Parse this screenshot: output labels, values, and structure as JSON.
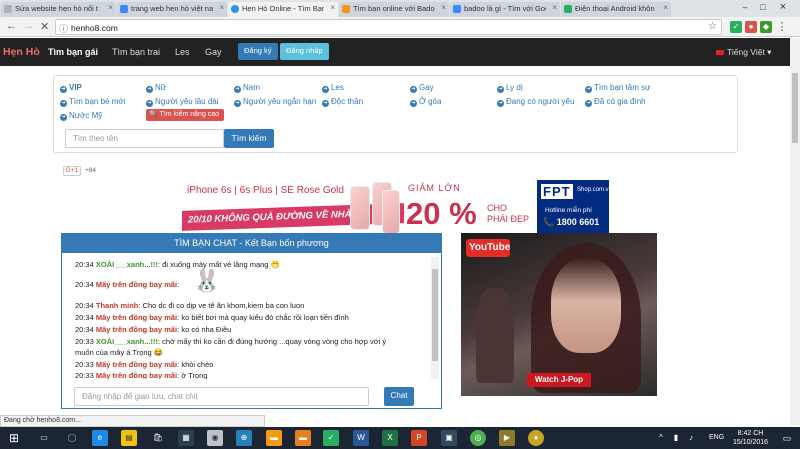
{
  "tabs": [
    {
      "title": "Sửa website hẹn hò nổi t",
      "color": "#b0b0b0",
      "letter": "T"
    },
    {
      "title": "trang web hen hò việt na",
      "color": "#4285f4",
      "letter": "G"
    },
    {
      "title": "Hẹn Hò Online - Tìm Bạn",
      "color": "#2196f3",
      "letter": ""
    },
    {
      "title": "Tìm bạn online với Badoo",
      "color": "#f7931e",
      "letter": "B"
    },
    {
      "title": "badoo là gì - Tìm với Goo",
      "color": "#4285f4",
      "letter": "G"
    },
    {
      "title": "Điện thoại Android khôn",
      "color": "#27ae60",
      "letter": ""
    }
  ],
  "browser": {
    "url": "henho8.com",
    "status": "Đang chờ henho8.com..."
  },
  "navbar": {
    "brand": "Hẹn Hò",
    "links": [
      "Tìm bạn gái",
      "Tìm bạn trai",
      "Les",
      "Gay"
    ],
    "register": "Đăng ký",
    "login": "Đăng nhập",
    "language": "Tiếng Việt"
  },
  "filters": [
    "VIP",
    "Nữ",
    "Nam",
    "Les",
    "Gay",
    "Ly dị",
    "Tìm bạn tâm sự",
    "Tìm bạn bè mới",
    "Người yêu lâu dài",
    "Người yêu ngắn hạn",
    "Độc thân",
    "Ở góa",
    "Đang có người yêu",
    "Đã có gia đình",
    "Nước Mỹ"
  ],
  "advanced_search": "Tìm kiếm nâng cao",
  "search": {
    "placeholder": "Tìm theo tên",
    "button": "Tìm kiếm"
  },
  "gplus": {
    "label": "G+1",
    "count": "+84"
  },
  "ad": {
    "line1": "iPhone 6s | 6s Plus | SE Rose Gold",
    "ribbon": "20/10 KHÔNG QUÀ ĐƯỜNG VỀ NHÀ",
    "giam": "GIẢM LỚN",
    "pct": "20 %",
    "cho": "CHO",
    "phai": "PHÁI ĐẸP",
    "brand": "FPT",
    "shop": "Shop.com.vn",
    "hotline": "Hotline miễn phí",
    "phone": "1800 6601"
  },
  "chat": {
    "title": "TÌM BẠN CHAT - Kết Bạn bốn phương",
    "messages": [
      {
        "time": "20:34",
        "user": "XOÀI___xanh...!!!",
        "color": "#3c9a2c",
        "text": ": đi xuống mày mất vé lăng mạng 😁"
      },
      {
        "time": "20:34",
        "user": "Mây trên đồng bay mãi",
        "color": "#c0392b",
        "text": ":"
      },
      {
        "time": "20:34",
        "user": "Thanh minh",
        "color": "#c0392b",
        "text": ": Cho dc đi co dịp ve tê ăn khom,kiem ba con luon"
      },
      {
        "time": "20:34",
        "user": "Mây trên đồng bay mãi",
        "color": "#c0392b",
        "text": ": ko biết bơi mà quay kiểu đó chắc rồi loạn tiền đình"
      },
      {
        "time": "20:34",
        "user": "Mây trên đồng bay mãi",
        "color": "#c0392b",
        "text": ": ko có nha Điêu"
      },
      {
        "time": "20:33",
        "user": "XOÀI___xanh...!!!",
        "color": "#3c9a2c",
        "text": ": chở mấy thì ko cần đi đúng hướng ...quay vòng vòng cho hợp với ý"
      },
      {
        "time": "",
        "user": "",
        "color": "#222",
        "text": "muốn của mây á Trọng 😂"
      },
      {
        "time": "20:33",
        "user": "Mây trên đồng bay mãi",
        "color": "#c0392b",
        "text": ": khỏi chèo"
      },
      {
        "time": "20:33",
        "user": "Mây trên đồng bay mãi",
        "color": "#c0392b",
        "text": ": ờ Trọng"
      }
    ],
    "input_placeholder": "Đăng nhập để giao lưu, chat chit",
    "send": "Chat"
  },
  "video": {
    "logo": "YouTube",
    "watch": "Watch J-Pop"
  },
  "taskbar": {
    "lang": "ENG",
    "time": "8:42 CH",
    "date": "15/10/2016"
  }
}
